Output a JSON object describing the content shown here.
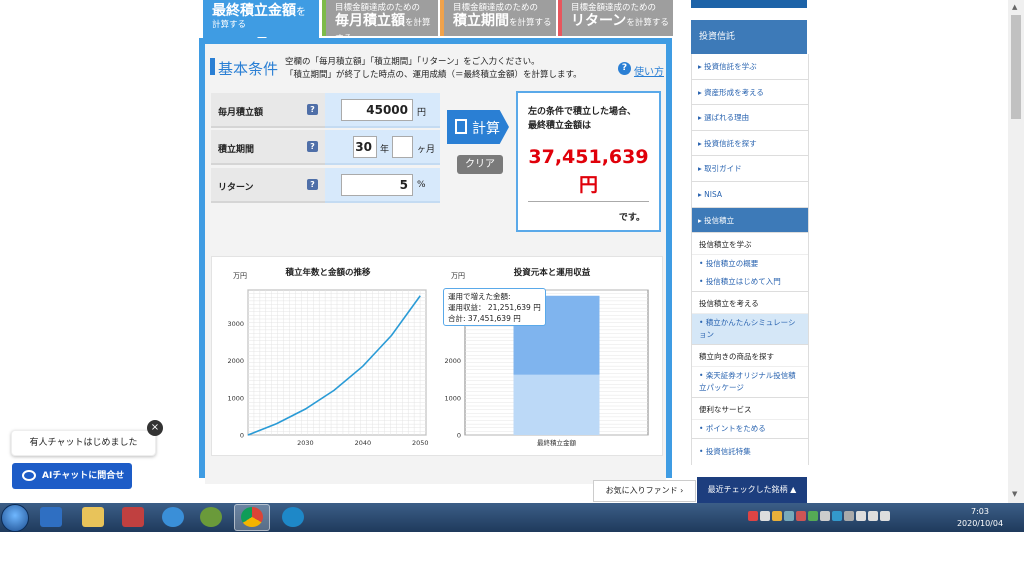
{
  "tabs": [
    {
      "small": "最終積立金額",
      "big": "を",
      "line2": "計算する",
      "active": true
    },
    {
      "small": "目標金額達成のための",
      "big": "毎月積立額",
      "suffix": "を計算する"
    },
    {
      "small": "目標金額達成のための",
      "big": "積立期間",
      "suffix": "を計算する"
    },
    {
      "small": "目標金額達成のための",
      "big": "リターン",
      "suffix": "を計算する"
    }
  ],
  "section": {
    "title": "基本条件",
    "desc1": "空欄の「毎月積立額」「積立期間」「リターン」をご入力ください。",
    "desc2": "「積立期間」が終了した時点の、運用成績（＝最終積立金額）を計算します。",
    "help": "使い方"
  },
  "form": {
    "monthly": {
      "label": "毎月積立額",
      "value": "45000",
      "unit": "円"
    },
    "period": {
      "label": "積立期間",
      "years": "30",
      "year_unit": "年",
      "months": "",
      "month_unit": "ヶ月"
    },
    "return": {
      "label": "リターン",
      "value": "5",
      "unit": "%"
    }
  },
  "buttons": {
    "calc": "計算",
    "clear": "クリア"
  },
  "result": {
    "line1": "左の条件で積立した場合、",
    "line2": "最終積立金額は",
    "amount": "37,451,639",
    "unit": "円",
    "suffix": "です。"
  },
  "chart_data": [
    {
      "type": "line",
      "title": "積立年数と金額の推移",
      "ylabel": "万円",
      "x_ticks": [
        "2030",
        "2040",
        "2050"
      ],
      "y_ticks": [
        "0",
        "1000",
        "2000",
        "3000"
      ],
      "xlim": [
        2020,
        2051
      ],
      "ylim": [
        0,
        3900
      ],
      "x": [
        2020,
        2025,
        2030,
        2035,
        2040,
        2045,
        2050
      ],
      "values": [
        0,
        306,
        699,
        1203,
        1850,
        2680,
        3745
      ],
      "color": "#2a9bd6"
    },
    {
      "type": "bar",
      "title": "投資元本と運用収益",
      "ylabel": "万円",
      "categories": [
        "最終積立金額"
      ],
      "y_ticks": [
        "0",
        "1000",
        "2000"
      ],
      "ylim": [
        0,
        3900
      ],
      "series": [
        {
          "values": [
            1620
          ],
          "color": "#bcd9f7"
        },
        {
          "values": [
            2125
          ],
          "color": "#7fb4ee"
        }
      ]
    }
  ],
  "tooltip": {
    "title": "運用で増えた金額:",
    "line1": "運用収益： 21,251,639 円",
    "line2": "合計: 37,451,639 円"
  },
  "sidebar": {
    "header": "投資信託",
    "items": [
      "投資信託を学ぶ",
      "資産形成を考える",
      "選ばれる理由",
      "投資信託を探す",
      "取引ガイド",
      "NISA"
    ],
    "active": "投信積立",
    "groups": [
      {
        "title": "投信積立を学ぶ",
        "links": [
          "投信積立の概要",
          "投信積立はじめて入門"
        ]
      },
      {
        "title": "投信積立を考える",
        "links": [
          "積立かんたんシミュレーション"
        ]
      },
      {
        "title": "積立向きの商品を探す",
        "links": [
          "楽天証券オリジナル投信積立パッケージ"
        ]
      },
      {
        "title": "便利なサービス",
        "links": [
          "ポイントをためる"
        ]
      }
    ],
    "last": "投資信託特集"
  },
  "bottom": {
    "fav": "お気に入りファンド ›",
    "recent": "最近チェックした銘柄 ▲"
  },
  "chat": {
    "bubble": "有人チャットはじめました",
    "button": "AIチャットに問合せ",
    "close": "×"
  },
  "taskbar": {
    "time": "7:03",
    "date": "2020/10/04"
  },
  "colors": {
    "accent": "#3f9ce3",
    "result_red": "#e0000a",
    "sidebar_blue": "#3d7ab8"
  }
}
